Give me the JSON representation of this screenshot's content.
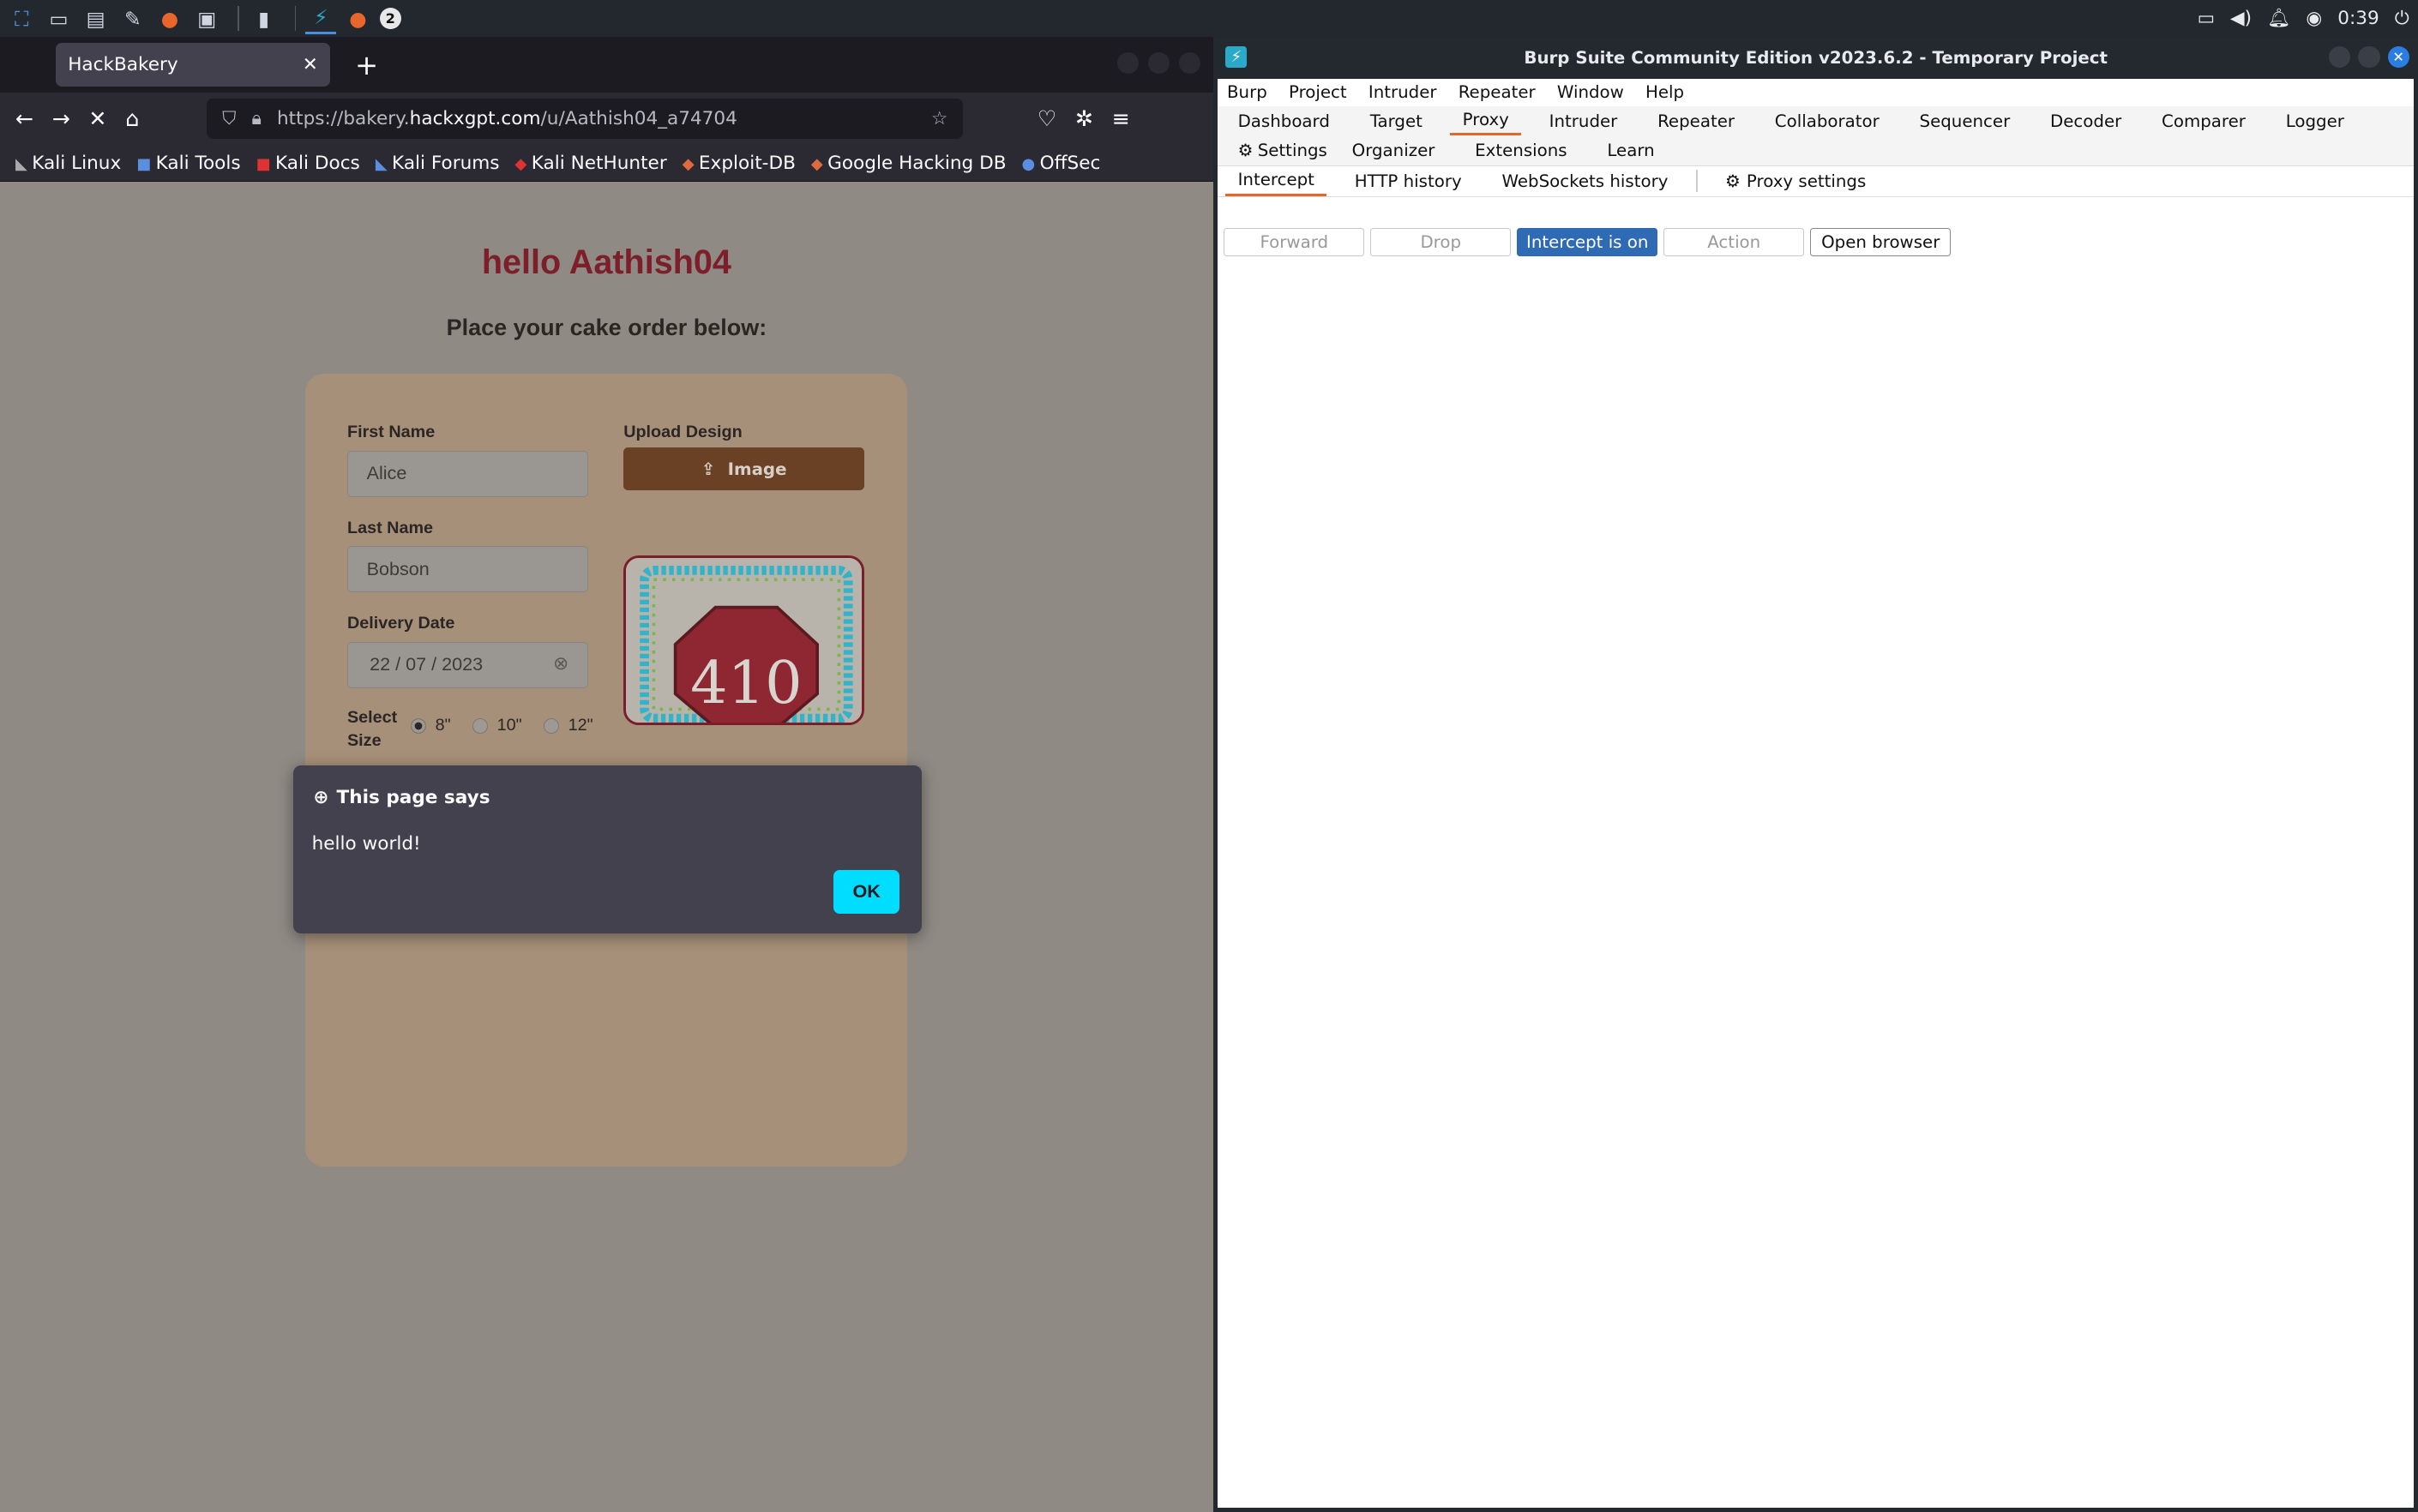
{
  "panel": {
    "clock": "0:39",
    "workspace_badge": "2"
  },
  "firefox": {
    "tab_title": "HackBakery",
    "url_prefix": "https://bakery.",
    "url_host": "hackxgpt.com",
    "url_path": "/u/Aathish04_a74704",
    "bookmarks": [
      "Kali Linux",
      "Kali Tools",
      "Kali Docs",
      "Kali Forums",
      "Kali NetHunter",
      "Exploit-DB",
      "Google Hacking DB",
      "OffSec"
    ]
  },
  "page": {
    "greeting": "hello Aathish04",
    "subtitle": "Place your cake order below:",
    "first_name_label": "First Name",
    "first_name_value": "Alice",
    "last_name_label": "Last Name",
    "last_name_value": "Bobson",
    "delivery_label": "Delivery Date",
    "delivery_value": "22 / 07 / 2023",
    "upload_label": "Upload Design",
    "upload_button": "Image",
    "size_label": "Select Size",
    "sizes": [
      "8\"",
      "10\"",
      "12\""
    ],
    "selected_size": "8\"",
    "cake_text": "410"
  },
  "dialog": {
    "title": "This page says",
    "message": "hello world!",
    "ok": "OK"
  },
  "burp": {
    "title": "Burp Suite Community Edition v2023.6.2 - Temporary Project",
    "menu": [
      "Burp",
      "Project",
      "Intruder",
      "Repeater",
      "Window",
      "Help"
    ],
    "tabs_row1": [
      "Dashboard",
      "Target",
      "Proxy",
      "Intruder",
      "Repeater",
      "Collaborator",
      "Sequencer",
      "Decoder",
      "Comparer",
      "Logger",
      "Settings"
    ],
    "tabs_row2": [
      "Organizer",
      "Extensions",
      "Learn"
    ],
    "active_tab": "Proxy",
    "subtabs": [
      "Intercept",
      "HTTP history",
      "WebSockets history"
    ],
    "proxy_settings": "Proxy settings",
    "active_subtab": "Intercept",
    "buttons": {
      "forward": "Forward",
      "drop": "Drop",
      "intercept": "Intercept is on",
      "action": "Action",
      "open_browser": "Open browser"
    },
    "colors": {
      "accent": "#e8642b",
      "primary_button": "#2f6ab5"
    }
  }
}
